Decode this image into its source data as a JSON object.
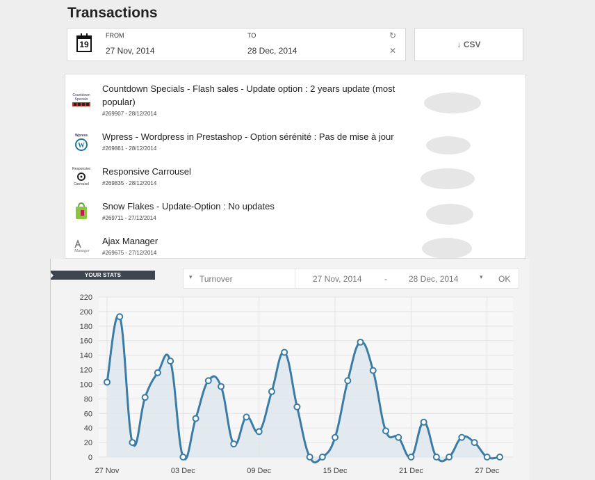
{
  "page": {
    "title": "Transactions"
  },
  "date_filter": {
    "from_label": "FROM",
    "from_value": "27 Nov, 2014",
    "to_label": "TO",
    "to_value": "28 Dec, 2014",
    "calendar_day": "19",
    "refresh_icon": "refresh-icon",
    "clear_icon": "close-icon"
  },
  "export": {
    "label": "↓ CSV"
  },
  "transactions": [
    {
      "name": "Countdown Specials - Flash sales - Update option : 2 years update (most popular)",
      "meta": "#269907 - 28/12/2014",
      "logo": "countdown-logo"
    },
    {
      "name": "Wpress - Wordpress in Prestashop - Option sérénité : Pas de mise à jour",
      "meta": "#269861 - 28/12/2014",
      "logo": "wordpress-logo"
    },
    {
      "name": "Responsive Carrousel",
      "meta": "#269835 - 28/12/2014",
      "logo": "carrousel-logo"
    },
    {
      "name": "Snow Flakes - Update-Option : No updates",
      "meta": "#269711 - 27/12/2014",
      "logo": "shopping-bag-logo"
    },
    {
      "name": "Ajax Manager",
      "meta": "#269675 - 27/12/2014",
      "logo": "ajax-manager-logo"
    }
  ],
  "logo_text": {
    "countdown_1": "Countdown",
    "countdown_2": "Specials",
    "wpress": "Wpress",
    "responsive": "Responsive",
    "carrousel": "Carrousel",
    "manager": "Manager"
  },
  "stats": {
    "tab_label": "YOUR STATS",
    "metric": "Turnover",
    "range_from": "27 Nov, 2014",
    "range_sep": "-",
    "range_to": "28 Dec, 2014",
    "ok_label": "OK",
    "line_color": "#3a7ca5",
    "fill_color": "#dde6ec"
  },
  "chart_data": {
    "type": "area",
    "x": [
      "27 Nov",
      "28 Nov",
      "29 Nov",
      "30 Nov",
      "01 Dec",
      "02 Dec",
      "03 Dec",
      "04 Dec",
      "05 Dec",
      "06 Dec",
      "07 Dec",
      "08 Dec",
      "09 Dec",
      "10 Dec",
      "11 Dec",
      "12 Dec",
      "13 Dec",
      "14 Dec",
      "15 Dec",
      "16 Dec",
      "17 Dec",
      "18 Dec",
      "19 Dec",
      "20 Dec",
      "21 Dec",
      "22 Dec",
      "23 Dec",
      "24 Dec",
      "25 Dec",
      "26 Dec",
      "27 Dec",
      "28 Dec"
    ],
    "x_tick_labels": [
      "27 Nov",
      "03 Dec",
      "09 Dec",
      "15 Dec",
      "21 Dec",
      "27 Dec"
    ],
    "series": [
      {
        "values": [
          103,
          193,
          20,
          82,
          116,
          132,
          0,
          53,
          105,
          97,
          18,
          55,
          35,
          90,
          144,
          69,
          0,
          0,
          27,
          105,
          158,
          119,
          36,
          27,
          0,
          48,
          0,
          0,
          27,
          20,
          0,
          0
        ]
      }
    ],
    "ylim": [
      0,
      220
    ],
    "y_ticks": [
      0,
      20,
      40,
      60,
      80,
      100,
      120,
      140,
      160,
      180,
      200,
      220
    ],
    "grid": true
  }
}
